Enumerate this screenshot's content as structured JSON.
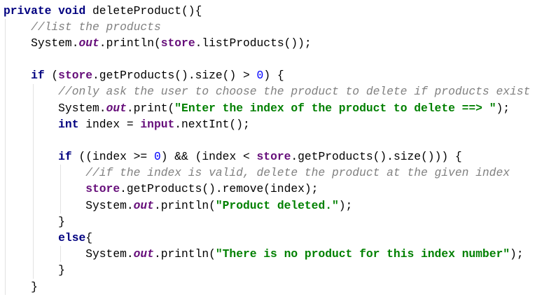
{
  "colors": {
    "background": "#FFFFFF",
    "text": "#000000",
    "keyword": "#000080",
    "comment": "#808080",
    "field": "#660E7A",
    "string": "#008000",
    "number": "#0000FF",
    "indent_guide": "#E2E2E2"
  },
  "code": {
    "lines": [
      [
        "private void",
        " deleteProduct(){"
      ],
      [
        "//list the products"
      ],
      [
        "System.",
        "out",
        ".println(",
        "store",
        ".listProducts());"
      ],
      [],
      [
        "if",
        " (",
        "store",
        ".getProducts().size() > ",
        "0",
        ") {"
      ],
      [
        "//only ask the user to choose the product to delete if products exist"
      ],
      [
        "System.",
        "out",
        ".print(",
        "\"Enter the index of the product to delete ==> \"",
        ");"
      ],
      [
        "int",
        " index = ",
        "input",
        ".nextInt();"
      ],
      [],
      [
        "if",
        " ((index >= ",
        "0",
        ") && (index < ",
        "store",
        ".getProducts().size())) {"
      ],
      [
        "//if the index is valid, delete the product at the given index"
      ],
      [
        "store",
        ".getProducts().remove(index);"
      ],
      [
        "System.",
        "out",
        ".println(",
        "\"Product deleted.\"",
        ");"
      ],
      [
        "}"
      ],
      [
        "else",
        "{"
      ],
      [
        "System.",
        "out",
        ".println(",
        "\"There is no product for this index number\"",
        ");"
      ],
      [
        "}"
      ],
      [
        "}"
      ]
    ]
  }
}
